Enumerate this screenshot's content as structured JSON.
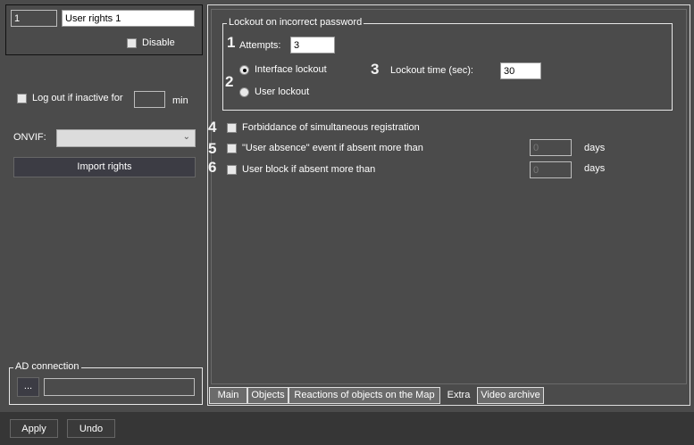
{
  "left": {
    "id_value": "1",
    "name_value": "User rights 1",
    "disable_label": "Disable",
    "logout_label": "Log out if inactive for",
    "logout_value": "",
    "logout_unit": "min",
    "onvif_label": "ONVIF:",
    "onvif_value": "",
    "import_label": "Import rights",
    "ad_legend": "AD connection",
    "ad_browse_label": "...",
    "ad_value": ""
  },
  "lockout": {
    "legend": "Lockout on incorrect password",
    "attempts_label": "Attempts:",
    "attempts_value": "3",
    "interface_label": "Interface lockout",
    "user_label": "User lockout",
    "time_label": "Lockout time (sec):",
    "time_value": "30"
  },
  "options": {
    "forbid_label": "Forbiddance of simultaneous registration",
    "absence_label": "\"User absence\" event if absent more than",
    "absence_value": "0",
    "absence_unit": "days",
    "block_label": "User block if absent more than",
    "block_value": "0",
    "block_unit": "days"
  },
  "markers": [
    "1",
    "2",
    "3",
    "4",
    "5",
    "6"
  ],
  "tabs": [
    "Main",
    "Objects",
    "Reactions of objects on the Map",
    "Extra",
    "Video archive"
  ],
  "footer": {
    "apply": "Apply",
    "undo": "Undo"
  }
}
